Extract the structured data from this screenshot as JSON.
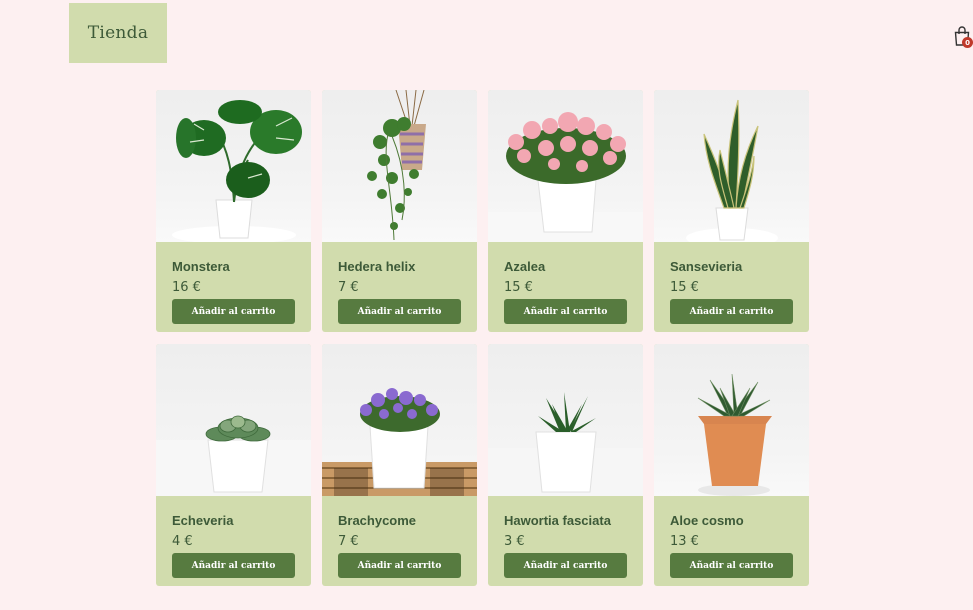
{
  "header": {
    "logo_text": "Tienda",
    "cart_count": "0"
  },
  "products": [
    {
      "name": "Monstera",
      "price": "16 €",
      "button": "Añadir al carrito"
    },
    {
      "name": "Hedera helix",
      "price": "7 €",
      "button": "Añadir al carrito"
    },
    {
      "name": "Azalea",
      "price": "15 €",
      "button": "Añadir al carrito"
    },
    {
      "name": "Sansevieria",
      "price": "15 €",
      "button": "Añadir al carrito"
    },
    {
      "name": "Echeveria",
      "price": "4 €",
      "button": "Añadir al carrito"
    },
    {
      "name": "Brachycome",
      "price": "7 €",
      "button": "Añadir al carrito"
    },
    {
      "name": "Hawortia fasciata",
      "price": "3 €",
      "button": "Añadir al carrito"
    },
    {
      "name": "Aloe cosmo",
      "price": "13 €",
      "button": "Añadir al carrito"
    }
  ],
  "colors": {
    "background": "#fdf0f1",
    "card": "#d1dcad",
    "button": "#577b40",
    "text": "#3d5a38",
    "badge": "#c0392b"
  },
  "icons": {
    "cart": "shopping-bag-icon"
  }
}
